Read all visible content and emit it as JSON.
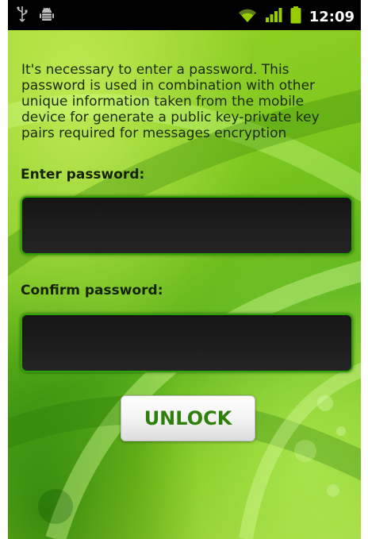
{
  "status_bar": {
    "clock": "12:09",
    "left_icons": [
      "usb-icon",
      "android-debug-icon"
    ],
    "right_icons": [
      "wifi-icon",
      "signal-icon",
      "battery-icon"
    ],
    "accent_color": "#99cc00"
  },
  "screen": {
    "info_text": "It's necessary to enter a password. This password is used in combination with other unique information taken from the mobile device for generate a public key-private key pairs required for messages encryption",
    "password_label": "Enter password:",
    "password_value": "",
    "confirm_label": "Confirm password:",
    "confirm_value": "",
    "unlock_label": "UNLOCK",
    "colors": {
      "background": "#7cc61e",
      "input_border": "#2fa300",
      "input_fill": "#1c1c1c",
      "button_text": "#2e7f0c"
    }
  }
}
